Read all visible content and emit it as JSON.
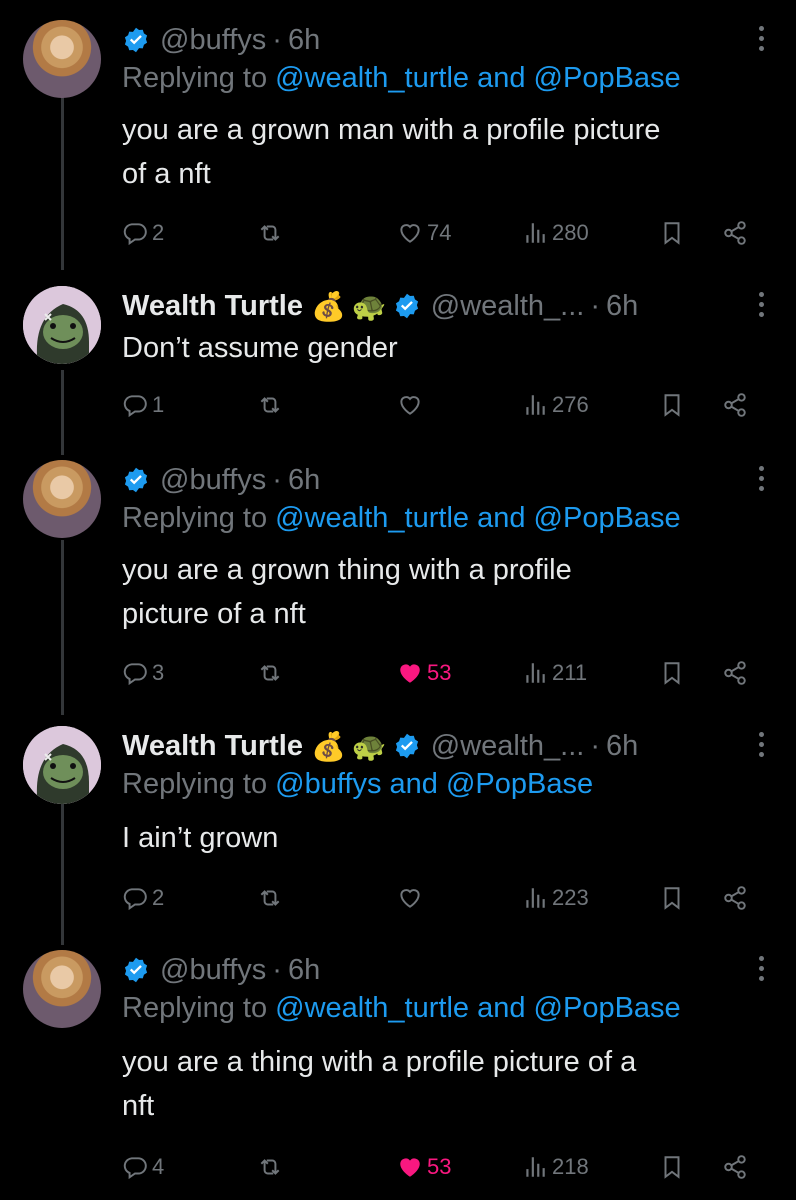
{
  "tweets": [
    {
      "author_name": "",
      "handle": "@buffys",
      "time": "6h",
      "reply_label": "Replying to",
      "reply_targets": [
        "@wealth_turtle",
        "@PopBase"
      ],
      "and_word": "and",
      "text_lines": [
        "you are a grown man with a profile picture",
        "of a nft"
      ],
      "replies": "2",
      "likes": "74",
      "liked": false,
      "views": "280"
    },
    {
      "author_name": "Wealth Turtle",
      "name_emojis": [
        "💰",
        "🐢"
      ],
      "handle": "@wealth_...",
      "time": "6h",
      "text_lines": [
        "Don’t assume gender"
      ],
      "replies": "1",
      "likes": "",
      "liked": false,
      "views": "276"
    },
    {
      "author_name": "",
      "handle": "@buffys",
      "time": "6h",
      "reply_label": "Replying to",
      "reply_targets": [
        "@wealth_turtle",
        "@PopBase"
      ],
      "and_word": "and",
      "text_lines": [
        "you are a grown thing with a profile",
        "picture of a nft"
      ],
      "replies": "3",
      "likes": "53",
      "liked": true,
      "views": "211"
    },
    {
      "author_name": "Wealth Turtle",
      "name_emojis": [
        "💰",
        "🐢"
      ],
      "handle": "@wealth_...",
      "time": "6h",
      "reply_label": "Replying to",
      "reply_targets": [
        "@buffys",
        "@PopBase"
      ],
      "and_word": "and",
      "text_lines": [
        "I ain’t grown"
      ],
      "replies": "2",
      "likes": "",
      "liked": false,
      "views": "223"
    },
    {
      "author_name": "",
      "handle": "@buffys",
      "time": "6h",
      "reply_label": "Replying to",
      "reply_targets": [
        "@wealth_turtle",
        "@PopBase"
      ],
      "and_word": "and",
      "text_lines": [
        "you are a thing with a profile picture of a",
        "nft"
      ],
      "replies": "4",
      "likes": "53",
      "liked": true,
      "views": "218"
    }
  ],
  "colors": {
    "background": "#000000",
    "text": "#e7e9ea",
    "muted": "#71767b",
    "link": "#1d9bf0",
    "like": "#f91880",
    "verified": "#1d9bf0"
  }
}
